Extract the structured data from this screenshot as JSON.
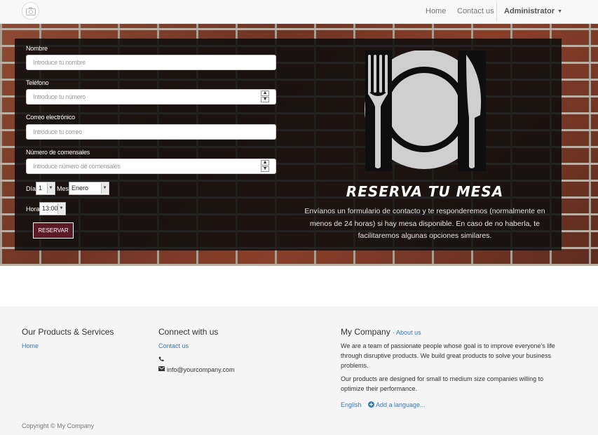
{
  "nav": {
    "home": "Home",
    "contact": "Contact us",
    "user": "Administrator"
  },
  "form": {
    "nombre_label": "Nombre",
    "nombre_placeholder": "Introduce tu nombre",
    "telefono_label": "Teléfono",
    "telefono_placeholder": "Introduce tu número",
    "correo_label": "Correo electrónico",
    "correo_placeholder": "Introduce tu correo",
    "comensales_label": "Número de comensales",
    "comensales_placeholder": "Introduce número de comensales",
    "dia_label": "Día",
    "dia_value": "1",
    "mes_label": "Mes",
    "mes_value": "Enero",
    "hora_label": "Hora",
    "hora_value": "13:00",
    "submit": "RESERVAR"
  },
  "hero": {
    "icon": "plate-fork-knife-icon",
    "title": "RESERVA TU MESA",
    "text": "Envíanos un formulario de contacto y te responderemos (normalmente en menos de 24 horas) si hay mesa disponible. En caso de no haberla, te facilitaremos algunas opciones similares."
  },
  "footer": {
    "products_title": "Our Products & Services",
    "products_home": "Home",
    "connect_title": "Connect with us",
    "connect_contact": "Contact us",
    "email": "info@yourcompany.com",
    "company_title": "My Company",
    "company_about_prefix": "- ",
    "company_about": "About us",
    "company_text1": "We are a team of passionate people whose goal is to improve everyone's life through disruptive products. We build great products to solve your business problems.",
    "company_text2": "Our products are designed for small to medium size companies willing to optimize their performance.",
    "lang_english": "English",
    "lang_add": "Add a language...",
    "copyright": "Copyright © My Company"
  },
  "colors": {
    "reservar_bg": "#5a1b25",
    "link": "#337ab7",
    "panel": "#0e0e0e"
  }
}
